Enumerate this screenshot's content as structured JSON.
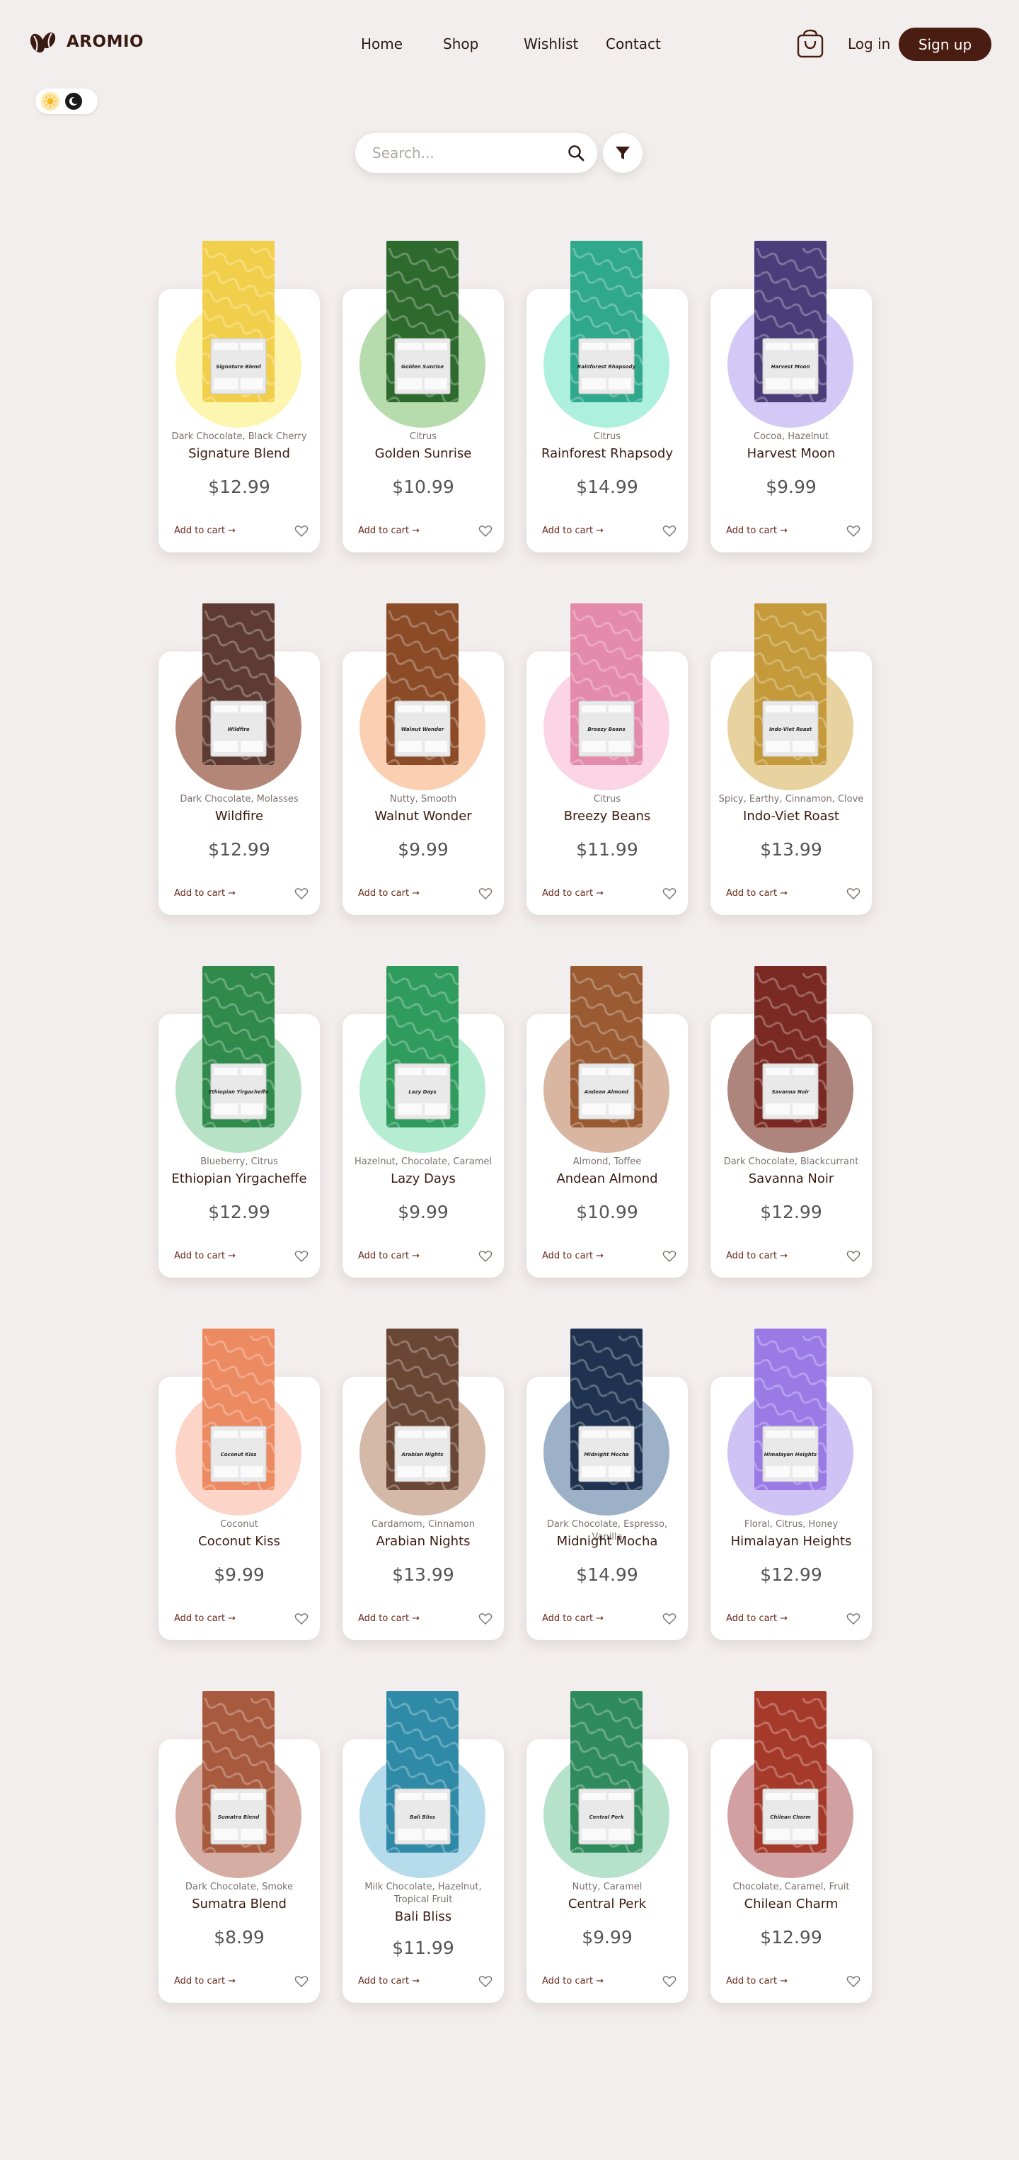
{
  "brand": {
    "name": "AROMIO"
  },
  "nav": {
    "items": [
      "Home",
      "Shop",
      "Wishlist",
      "Contact"
    ]
  },
  "auth": {
    "login": "Log in",
    "signup": "Sign up"
  },
  "search": {
    "placeholder": "Search..."
  },
  "colors": {
    "brand": "#4a1d13",
    "background": "#f2eeed",
    "card": "#ffffff"
  },
  "product_card": {
    "add_label": "Add to cart →"
  },
  "products": [
    {
      "notes": "Dark Chocolate, Black Cherry",
      "name": "Signature Blend",
      "price": "$12.99",
      "bag_label": "Signature Blend",
      "bag_color": "#f2cf4b",
      "circle_color": "#fdf6b0"
    },
    {
      "notes": "Citrus",
      "name": "Golden Sunrise",
      "price": "$10.99",
      "bag_label": "Golden Sunrise",
      "bag_color": "#2e6a2e",
      "circle_color": "#b6dcae"
    },
    {
      "notes": "Citrus",
      "name": "Rainforest Rhapsody",
      "price": "$14.99",
      "bag_label": "Rainforest Rhapsody",
      "bag_color": "#2fa88c",
      "circle_color": "#aef0de"
    },
    {
      "notes": "Cocoa, Hazelnut",
      "name": "Harvest Moon",
      "price": "$9.99",
      "bag_label": "Harvest Moon",
      "bag_color": "#4b3d7a",
      "circle_color": "#d3c8f6"
    },
    {
      "notes": "Dark Chocolate, Molasses",
      "name": "Wildfire",
      "price": "$12.99",
      "bag_label": "Wildfire",
      "bag_color": "#5e3b32",
      "circle_color": "#b48677"
    },
    {
      "notes": "Nutty, Smooth",
      "name": "Walnut Wonder",
      "price": "$9.99",
      "bag_label": "Walnut Wonder",
      "bag_color": "#8b4b27",
      "circle_color": "#fbd0b2"
    },
    {
      "notes": "Citrus",
      "name": "Breezy Beans",
      "price": "$11.99",
      "bag_label": "Breezy Beans",
      "bag_color": "#e48aab",
      "circle_color": "#fbd4e6"
    },
    {
      "notes": "Spicy, Earthy, Cinnamon, Clove",
      "name": "Indo-Viet Roast",
      "price": "$13.99",
      "bag_label": "Indo-Viet Roast",
      "bag_color": "#c49a3a",
      "circle_color": "#e8d3a0"
    },
    {
      "notes": "Blueberry, Citrus",
      "name": "Ethiopian Yirgacheffe",
      "price": "$12.99",
      "bag_label": "Ethiopian Yirgacheffe",
      "bag_color": "#2f8a4c",
      "circle_color": "#b8e2c6"
    },
    {
      "notes": "Hazelnut, Chocolate, Caramel",
      "name": "Lazy Days",
      "price": "$9.99",
      "bag_label": "Lazy Days",
      "bag_color": "#2f9b5c",
      "circle_color": "#b6ecd2"
    },
    {
      "notes": "Almond, Toffee",
      "name": "Andean Almond",
      "price": "$10.99",
      "bag_label": "Andean Almond",
      "bag_color": "#9a5a32",
      "circle_color": "#d8b6a2"
    },
    {
      "notes": "Dark Chocolate, Blackcurrant",
      "name": "Savanna Noir",
      "price": "$12.99",
      "bag_label": "Savanna Noir",
      "bag_color": "#7a2a22",
      "circle_color": "#ae857c"
    },
    {
      "notes": "Coconut",
      "name": "Coconut Kiss",
      "price": "$9.99",
      "bag_label": "Coconut Kiss",
      "bag_color": "#ec8a62",
      "circle_color": "#fcd4c8"
    },
    {
      "notes": "Cardamom, Cinnamon",
      "name": "Arabian Nights",
      "price": "$13.99",
      "bag_label": "Arabian Nights",
      "bag_color": "#6a4634",
      "circle_color": "#d4b8a8"
    },
    {
      "notes": "Dark Chocolate, Espresso, Vanilla",
      "name": "Midnight Mocha",
      "price": "$14.99",
      "bag_label": "Midnight Mocha",
      "bag_color": "#1f3350",
      "circle_color": "#9cb0c8"
    },
    {
      "notes": "Floral, Citrus, Honey",
      "name": "Himalayan Heights",
      "price": "$12.99",
      "bag_label": "Himalayan Heights",
      "bag_color": "#9a7be6",
      "circle_color": "#cfc2f4"
    },
    {
      "notes": "Dark Chocolate, Smoke",
      "name": "Sumatra Blend",
      "price": "$8.99",
      "bag_label": "Sumatra Blend",
      "bag_color": "#a85a3e",
      "circle_color": "#d6ada2"
    },
    {
      "notes": "Milk Chocolate, Hazelnut, Tropical Fruit",
      "name": "Bali Bliss",
      "price": "$11.99",
      "bag_label": "Bali Bliss",
      "bag_color": "#2f8aa8",
      "circle_color": "#b6dcec"
    },
    {
      "notes": "Nutty, Caramel",
      "name": "Central Perk",
      "price": "$9.99",
      "bag_label": "Central Perk",
      "bag_color": "#2f8a5c",
      "circle_color": "#b6e2cc"
    },
    {
      "notes": "Chocolate, Caramel, Fruit",
      "name": "Chilean Charm",
      "price": "$12.99",
      "bag_label": "Chilean Charm",
      "bag_color": "#a63a2a",
      "circle_color": "#d2a0a0"
    }
  ]
}
